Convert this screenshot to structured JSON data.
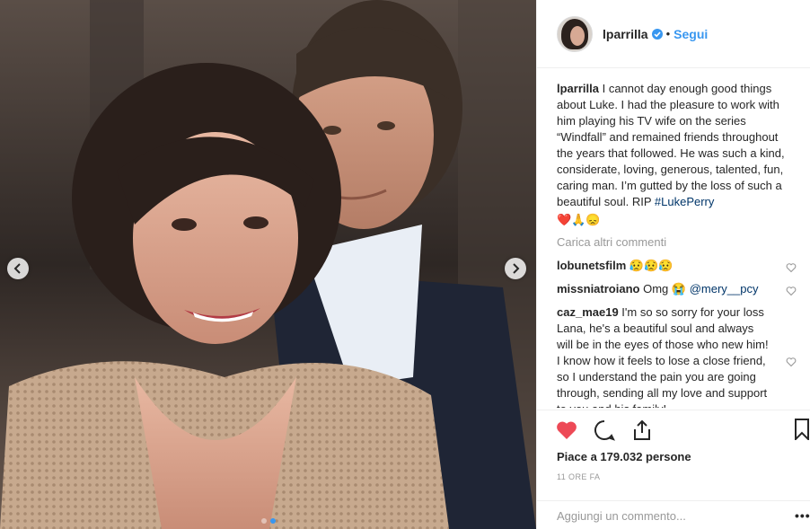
{
  "photo": {
    "dots": 2,
    "active_dot": 1
  },
  "header": {
    "username": "lparrilla",
    "separator": "•",
    "follow_label": "Segui"
  },
  "caption": {
    "username": "lparrilla",
    "text": "I cannot day enough good things about Luke. I had the pleasure to work with him playing his TV wife on the series “Windfall” and remained friends throughout the years that followed. He was such a kind, considerate, loving, generous, talented, fun, caring man. I’m gutted by the loss of such a beautiful soul. RIP",
    "hashtag": "#LukePerry",
    "emojis": "❤️🙏😞"
  },
  "load_more_label": "Carica altri commenti",
  "comments": [
    {
      "username": "lobunetsfilm",
      "text": "😥😥😥",
      "mention": ""
    },
    {
      "username": "missniatroiano",
      "text": "Omg 😭",
      "mention": "@mery__pcy"
    },
    {
      "username": "caz_mae19",
      "text": "I'm so so sorry for your loss Lana, he's a beautiful soul and always will be in the eyes of those who new him! I know how it feels to lose a close friend, so I understand the pain you are going through, sending all my love and support to you and his family!",
      "mention": ""
    }
  ],
  "likes_text": "Piace a 179.032 persone",
  "timestamp": "11 ORE FA",
  "add_comment_placeholder": "Aggiungi un commento...",
  "more_label": "•••",
  "colors": {
    "accent": "#3897f0",
    "like_red": "#ed4956",
    "link": "#003569",
    "muted": "#999999"
  },
  "icons": [
    "chevron-left-icon",
    "chevron-right-icon",
    "verified-icon",
    "heart-filled-icon",
    "comment-icon",
    "share-icon",
    "bookmark-icon",
    "heart-outline-icon"
  ]
}
